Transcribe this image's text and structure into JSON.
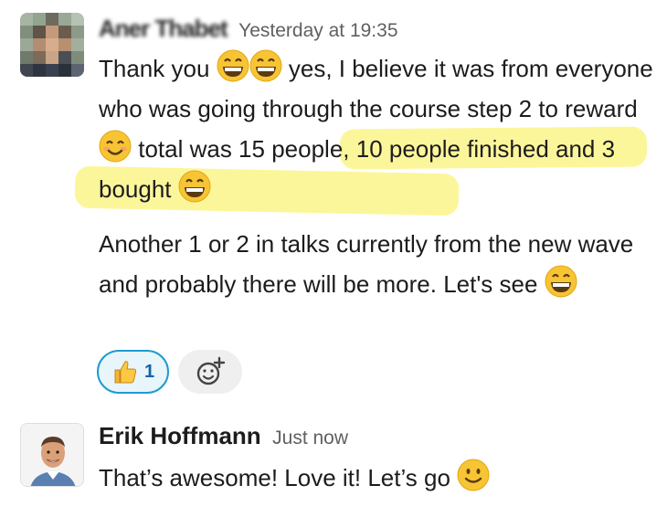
{
  "message1": {
    "sender": "Aner Thabet",
    "timestamp": "Yesterday at 19:35",
    "line1_before": "Thank you ",
    "line1_after": " yes, I believe it was from everyone who was going through the course step 2 to reward ",
    "highlighted": "total was 15 people, 10 people finished and 3 bought",
    "paragraph2": "Another 1 or 2 in talks currently from the new wave and probably there will be more. Let's see ",
    "reactions": [
      {
        "emoji": "thumbs-up",
        "count": "1"
      }
    ],
    "highlight_color": "#fbf48a"
  },
  "message2": {
    "sender": "Erik Hoffmann",
    "timestamp": "Just now",
    "text": "That’s awesome! Love it! Let’s go "
  },
  "colors": {
    "reaction_border": "#1d9bd1",
    "reaction_bg": "#e8f5fa",
    "reaction_count": "#1264a3",
    "timestamp": "#616061"
  }
}
